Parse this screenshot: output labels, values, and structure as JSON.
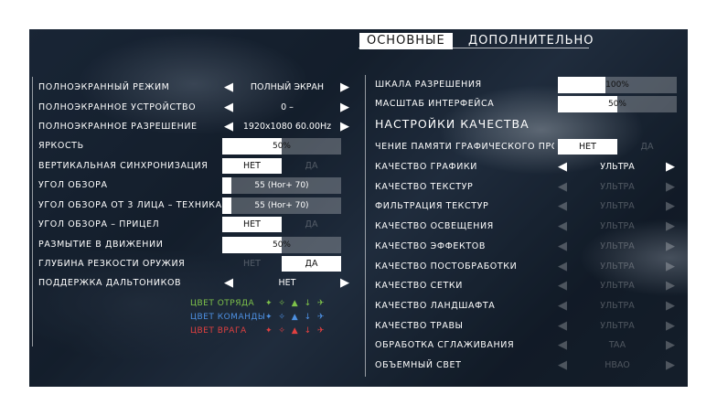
{
  "tabs": {
    "basic": "ОСНОВНЫЕ",
    "advanced": "ДОПОЛНИТЕЛЬНО"
  },
  "left": {
    "fullscreen_mode": {
      "label": "ПОЛНОЭКРАННЫЙ РЕЖИМ",
      "value": "ПОЛНЫЙ ЭКРАН"
    },
    "fullscreen_device": {
      "label": "ПОЛНОЭКРАННОЕ УСТРОЙСТВО",
      "value": "0 –"
    },
    "fullscreen_resolution": {
      "label": "ПОЛНОЭКРАННОЕ РАЗРЕШЕНИЕ",
      "value": "1920x1080 60.00Hz"
    },
    "brightness": {
      "label": "ЯРКОСТЬ",
      "value": "50%",
      "level": 0.5
    },
    "vsync": {
      "label": "ВЕРТИКАЛЬНАЯ СИНХРОНИЗАЦИЯ",
      "off": "НЕТ",
      "on": "ДА",
      "selected": "off"
    },
    "fov": {
      "label": "УГОЛ ОБЗОРА",
      "value": "55 (Hor+ 70)",
      "level": 0.08
    },
    "fov_vehicle": {
      "label": "УГОЛ ОБЗОРА ОТ 3 ЛИЦА – ТЕХНИКА",
      "value": "55 (Hor+ 70)",
      "level": 0.08
    },
    "fov_ads": {
      "label": "УГОЛ ОБЗОРА – ПРИЦЕЛ",
      "off": "НЕТ",
      "on": "ДА",
      "selected": "off"
    },
    "motion_blur": {
      "label": "РАЗМЫТИЕ В ДВИЖЕНИИ",
      "value": "50%",
      "level": 0.5
    },
    "weapon_dof": {
      "label": "ГЛУБИНА РЕЗКОСТИ ОРУЖИЯ",
      "off": "НЕТ",
      "on": "ДА",
      "selected": "on"
    },
    "colorblind": {
      "label": "ПОДДЕРЖКА ДАЛЬТОНИКОВ",
      "value": "НЕТ"
    },
    "color_squad": {
      "label": "ЦВЕТ ОТРЯДА",
      "color": "#7ec24a"
    },
    "color_team": {
      "label": "ЦВЕТ КОМАНДЫ",
      "color": "#4d8fe0"
    },
    "color_enemy": {
      "label": "ЦВЕТ ВРАГА",
      "color": "#e04040"
    }
  },
  "right": {
    "resolution_scale": {
      "label": "ШКАЛА РАЗРЕШЕНИЯ",
      "value": "100%",
      "level": 0.4
    },
    "ui_scale": {
      "label": "МАСШТАБ ИНТЕРФЕЙСА",
      "value": "50%",
      "level": 0.5
    },
    "quality_heading": "НАСТРОЙКИ КАЧЕСТВА",
    "gpu_memory": {
      "label": "ЧЕНИЕ ПАМЯТИ ГРАФИЧЕСКОГО ПРО",
      "off": "НЕТ",
      "on": "ДА",
      "selected": "off"
    },
    "graphics_quality": {
      "label": "КАЧЕСТВО ГРАФИКИ",
      "value": "УЛЬТРА"
    },
    "texture_quality": {
      "label": "КАЧЕСТВО ТЕКСТУР",
      "value": "УЛЬТРА"
    },
    "texture_filtering": {
      "label": "ФИЛЬТРАЦИЯ ТЕКСТУР",
      "value": "УЛЬТРА"
    },
    "lighting_quality": {
      "label": "КАЧЕСТВО ОСВЕЩЕНИЯ",
      "value": "УЛЬТРА"
    },
    "effects_quality": {
      "label": "КАЧЕСТВО ЭФФЕКТОВ",
      "value": "УЛЬТРА"
    },
    "postprocess_quality": {
      "label": "КАЧЕСТВО ПОСТОБРАБОТКИ",
      "value": "УЛЬТРА"
    },
    "mesh_quality": {
      "label": "КАЧЕСТВО СЕТКИ",
      "value": "УЛЬТРА"
    },
    "terrain_quality": {
      "label": "КАЧЕСТВО ЛАНДШАФТА",
      "value": "УЛЬТРА"
    },
    "grass_quality": {
      "label": "КАЧЕСТВО ТРАВЫ",
      "value": "УЛЬТРА"
    },
    "antialiasing": {
      "label": "ОБРАБОТКА СГЛАЖИВАНИЯ",
      "value": "TAA"
    },
    "volumetric_light": {
      "label": "ОБЪЕМНЫЙ СВЕТ",
      "value": "HBAO"
    }
  },
  "icons": {
    "left_arrow": "◀",
    "right_arrow": "▶",
    "unit_icons": "✦ ✧ ▲ ↓ ✈"
  }
}
